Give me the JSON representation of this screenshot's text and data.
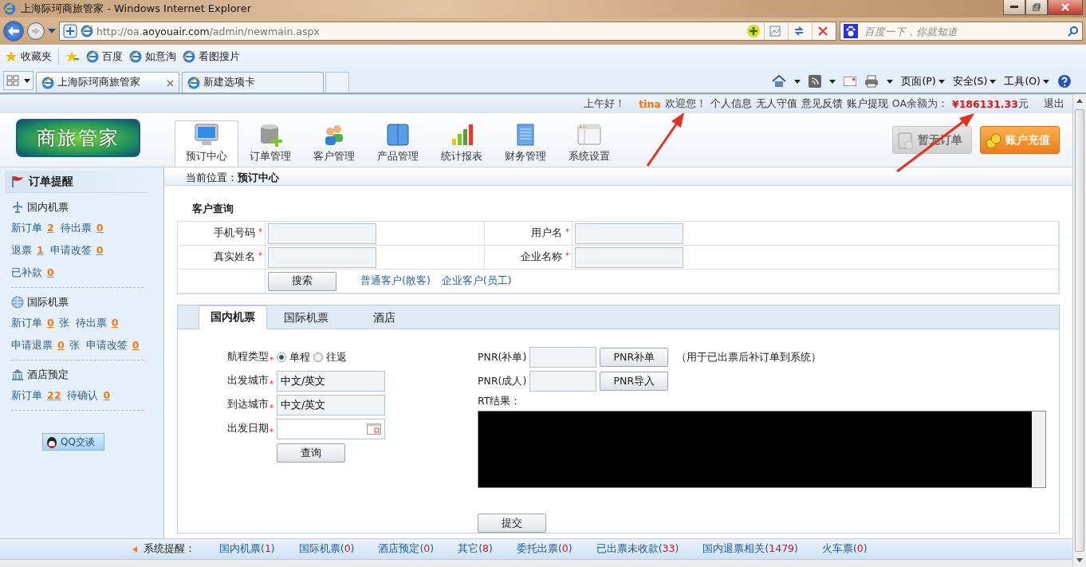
{
  "browser": {
    "title": "上海际珂商旅管家 - Windows Internet Explorer",
    "url": "http://oa.**aoyouair.com**/admin/newmain.aspx",
    "search_placeholder": "百度一下，你就知道",
    "favorites": {
      "label": "收藏夹",
      "links": [
        "百度",
        "如意淘",
        "看图搜片"
      ]
    },
    "tabs": [
      {
        "label": "上海际珂商旅管家",
        "selected": true
      },
      {
        "label": "新建选项卡",
        "selected": false
      }
    ],
    "commands": [
      "页面(P)",
      "安全(S)",
      "工具(O)"
    ]
  },
  "topbar": {
    "greeting": "上午好！",
    "user": "tina",
    "welcome": "欢迎您！",
    "links": [
      "个人信息",
      "无人守值",
      "意见反馈",
      "账户提现"
    ],
    "balance_label": "OA余额为：",
    "balance": "¥186131.33",
    "unit": "元",
    "logout": "退出"
  },
  "logo": "商旅管家",
  "nav": [
    {
      "kind": "monitor",
      "label": "预订中心",
      "selected": true
    },
    {
      "kind": "database",
      "label": "订单管理",
      "selected": false
    },
    {
      "kind": "people",
      "label": "客户管理",
      "selected": false
    },
    {
      "kind": "app",
      "label": "产品管理",
      "selected": false
    },
    {
      "kind": "chart",
      "label": "统计报表",
      "selected": false
    },
    {
      "kind": "document",
      "label": "财务管理",
      "selected": false
    },
    {
      "kind": "window",
      "label": "系统设置",
      "selected": false
    }
  ],
  "header_buttons": [
    {
      "kind": "orders",
      "label": "暂无订单",
      "disabled": true
    },
    {
      "kind": "recharge",
      "label": "账户充值",
      "disabled": false
    }
  ],
  "sidebar": {
    "title": "订单提醒",
    "sections": [
      {
        "kind": "plane",
        "title": "国内机票",
        "rows": [
          [
            {
              "label": "新订单",
              "count": "2"
            },
            {
              "label": "待出票",
              "count": "0"
            }
          ],
          [
            {
              "label": "退票",
              "count": "1"
            },
            {
              "label": "申请改签",
              "count": "0"
            }
          ],
          [
            {
              "label": "已补款",
              "count": "0"
            }
          ]
        ]
      },
      {
        "kind": "globe",
        "title": "国际机票",
        "rows": [
          [
            {
              "label": "新订单",
              "count": "0",
              "unit": "张"
            },
            {
              "label": "待出票",
              "count": "0"
            }
          ],
          [
            {
              "label": "申请退票",
              "count": "0",
              "unit": "张"
            },
            {
              "label": "申请改签",
              "count": "0"
            }
          ]
        ]
      },
      {
        "kind": "building",
        "title": "酒店预定",
        "rows": [
          [
            {
              "label": "新订单",
              "count": "22"
            },
            {
              "label": "待确认",
              "count": "0"
            }
          ]
        ]
      }
    ],
    "chat_button": "QQ交谈"
  },
  "breadcrumb": {
    "label": "当前位置：",
    "current": "预订中心"
  },
  "customer_query": {
    "title": "客户查询",
    "fields": [
      {
        "label": "手机号码",
        "mark": "*"
      },
      {
        "label": "用户名",
        "mark": "*"
      },
      {
        "label": "真实姓名",
        "mark": "*"
      },
      {
        "label": "企业名称",
        "mark": "*"
      }
    ],
    "search_button": "搜索",
    "links": [
      "普通客户(散客)",
      "企业客户(员工)"
    ]
  },
  "booking_tabs": [
    {
      "label": "国内机票",
      "selected": true
    },
    {
      "label": "国际机票",
      "selected": false
    },
    {
      "label": "酒店",
      "selected": false
    }
  ],
  "flight_form": {
    "trip_type": {
      "label": "航程类型",
      "mark": "*",
      "options": [
        {
          "label": "单程",
          "selected": true
        },
        {
          "label": "往返",
          "selected": false
        }
      ]
    },
    "fields": [
      {
        "kind": "text",
        "label": "出发城市",
        "mark": "*",
        "value": "中文/英文"
      },
      {
        "kind": "text",
        "label": "到达城市",
        "mark": "*",
        "value": "中文/英文"
      },
      {
        "kind": "date",
        "label": "出发日期",
        "mark": "*"
      }
    ],
    "button": "查询"
  },
  "pnr": {
    "rows": [
      {
        "label": "PNR(补单)",
        "button": "PNR补单",
        "note": "（用于已出票后补订单到系统）"
      },
      {
        "label": "PNR(成人)",
        "button": "PNR导入"
      }
    ],
    "result_label": "RT结果：",
    "submit": "提交"
  },
  "reminders": {
    "label": "系统提醒：",
    "items": [
      {
        "label": "国内机票(",
        "count": "1",
        "tail": ")"
      },
      {
        "label": "国际机票(",
        "count": "0",
        "tail": ")"
      },
      {
        "label": "酒店预定(",
        "count": "0",
        "tail": ")"
      },
      {
        "label": "其它(",
        "count": "8",
        "tail": ")"
      },
      {
        "label": "委托出票(",
        "count": "0",
        "tail": ")"
      },
      {
        "label": "已出票未收款(",
        "count": "33",
        "tail": ")"
      },
      {
        "label": "国内退票相关(",
        "count": "1479",
        "tail": ")"
      },
      {
        "label": "火车票(",
        "count": "0",
        "tail": ")"
      }
    ]
  }
}
